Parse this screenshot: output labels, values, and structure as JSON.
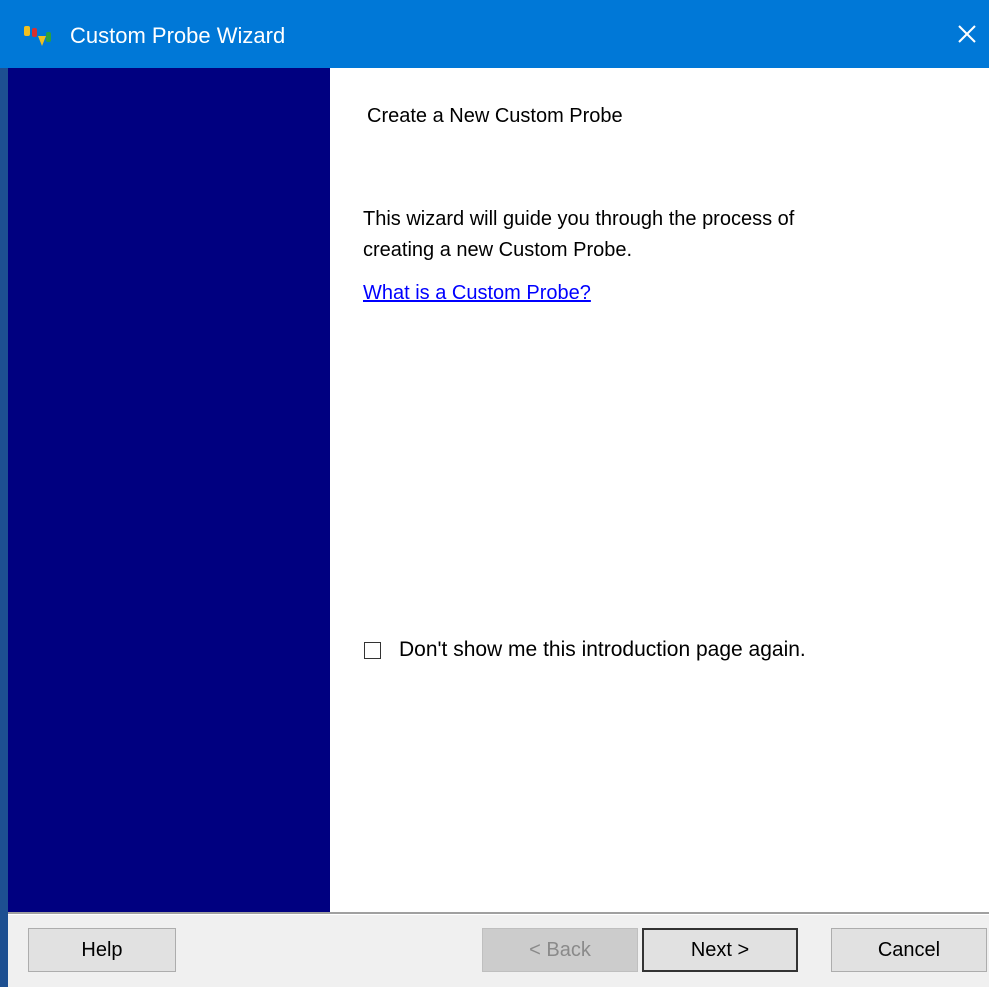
{
  "window": {
    "title": "Custom Probe Wizard",
    "accent_color": "#0078d7",
    "banner_color": "#000080"
  },
  "titlebar": {
    "icon": "probe-app-icon",
    "close_icon": "close-icon"
  },
  "page": {
    "title": "Create a New Custom Probe",
    "intro_line1": "This wizard will guide you through the process of",
    "intro_line2": "creating a new Custom Probe.",
    "link_text": "What is a Custom Probe?",
    "checkbox_label": "Don't show me this introduction page again.",
    "checkbox_checked": false
  },
  "buttons": {
    "help": "Help",
    "back": "< Back",
    "next": "Next >",
    "cancel": "Cancel"
  }
}
